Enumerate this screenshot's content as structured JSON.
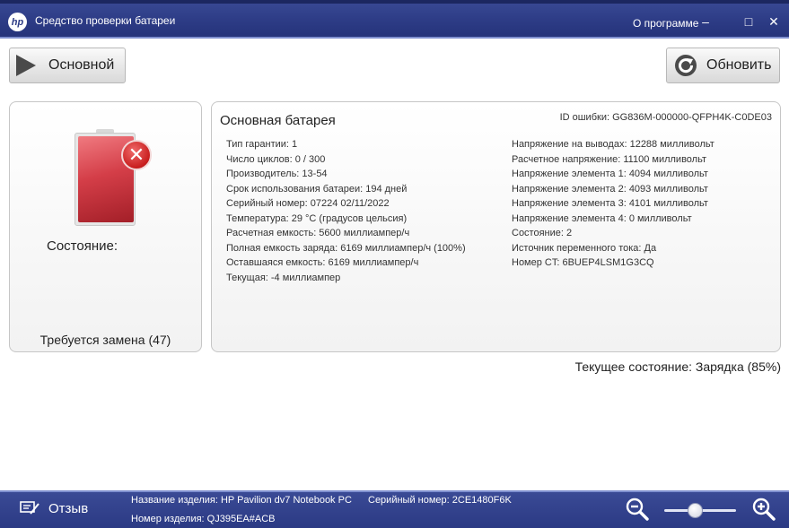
{
  "titlebar": {
    "logo_text": "hp",
    "title": "Средство проверки батареи",
    "about": "О программе",
    "minimize": "–",
    "maximize": "□",
    "close": "✕"
  },
  "toolbar": {
    "main_label": "Основной",
    "refresh_label": "Обновить"
  },
  "status_panel": {
    "status_label": "Состояние:",
    "status_text": "Требуется замена (47)",
    "status_color": "#c81e1e"
  },
  "battery_panel": {
    "title": "Основная батарея",
    "error_id": "ID ошибки: GG836M-000000-QFPH4K-C0DE03",
    "left_details": [
      "Тип гарантии: 1",
      "Число циклов: 0 / 300",
      "Производитель: 13-54",
      "Срок использования батареи: 194 дней",
      "Серийный номер: 07224 02/11/2022",
      "Температура: 29 °C (градусов цельсия)",
      "Расчетная емкость: 5600 миллиампер/ч",
      "Полная емкость заряда: 6169 миллиампер/ч (100%)",
      "Оставшаяся емкость: 6169 миллиампер/ч",
      "Текущая: -4 миллиампер"
    ],
    "right_details": [
      "Напряжение на выводах: 12288 милливольт",
      "Расчетное напряжение: 11100 милливольт",
      "Напряжение элемента 1: 4094 милливольт",
      "Напряжение элемента 2: 4093 милливольт",
      "Напряжение элемента 3: 4101 милливольт",
      "Напряжение элемента 4: 0 милливольт",
      "Состояние: 2",
      "Источник переменного тока: Да",
      "Номер CT: 6BUEP4LSM1G3CQ"
    ]
  },
  "current_state": "Текущее состояние: Зарядка (85%)",
  "footer": {
    "feedback_label": "Отзыв",
    "product_name": "Название изделия: HP Pavilion dv7 Notebook PC",
    "serial_number": "Серийный номер: 2CE1480F6K",
    "product_number": "Номер изделия: QJ395EA#ACB",
    "zoom_level": 0.45
  },
  "colors": {
    "titlebar_bg": "#2d3c86",
    "footer_bg": "#2b3a84",
    "battery_fill": "#d43e48"
  }
}
